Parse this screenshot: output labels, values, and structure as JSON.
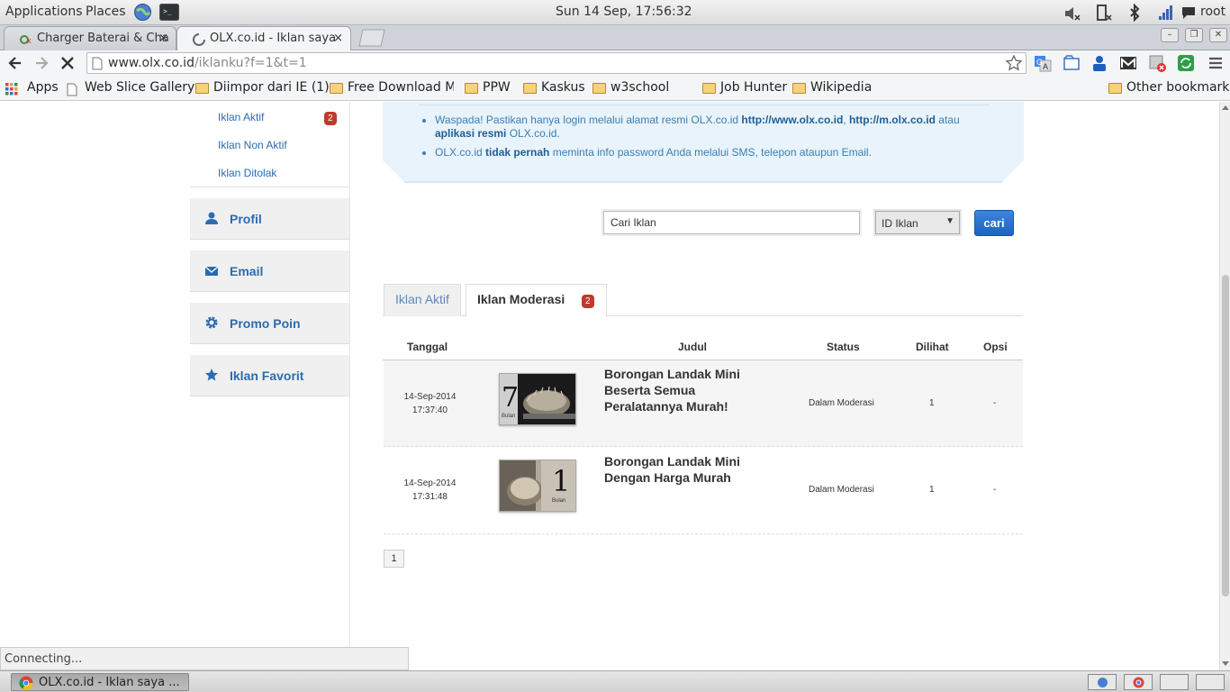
{
  "system_panel": {
    "applications": "Applications",
    "places": "Places",
    "clock": "Sun 14 Sep, 17:56:32",
    "user": "root"
  },
  "browser": {
    "tabs": [
      {
        "title": "Charger Baterai & Cha",
        "close": "×"
      },
      {
        "title": "OLX.co.id - Iklan saya",
        "close": "×"
      }
    ],
    "window_buttons": [
      "–",
      "❐",
      "✕"
    ],
    "url_host": "www.olx.co.id",
    "url_path": "/iklanku?f=1&t=1",
    "bookmarks": [
      "Apps",
      "Web Slice Gallery",
      "Diimpor dari IE (1)",
      "Free Download MF",
      "PPW",
      "Kaskus",
      "w3school",
      "Job Hunter",
      "Wikipedia"
    ],
    "other_bookmarks": "Other bookmarks",
    "status": "Connecting..."
  },
  "sidebar": {
    "submenu": [
      {
        "label": "Iklan Aktif",
        "badge": "2"
      },
      {
        "label": "Iklan Non Aktif"
      },
      {
        "label": "Iklan Ditolak"
      }
    ],
    "buttons": [
      "Profil",
      "Email",
      "Promo Poin",
      "Iklan Favorit"
    ]
  },
  "notice": {
    "item1_pre": "Waspada! Pastikan hanya login melalui alamat resmi OLX.co.id ",
    "item1_link1": "http://www.olx.co.id",
    "item1_sep": ", ",
    "item1_link2": "http://m.olx.co.id",
    "item1_mid": " atau ",
    "item1_bold": "aplikasi resmi",
    "item1_post": " OLX.co.id.",
    "item2_pre": "OLX.co.id ",
    "item2_bold": "tidak pernah",
    "item2_post": " meminta info password Anda melalui SMS, telepon ataupun Email."
  },
  "search": {
    "input_value": "Cari Iklan",
    "select_value": "ID Iklan",
    "button": "cari"
  },
  "listing_tabs": {
    "inactive": "Iklan Aktif",
    "active": "Iklan Moderasi",
    "active_badge": "2"
  },
  "table": {
    "headers": [
      "Tanggal",
      "Judul",
      "Status",
      "Dilihat",
      "Opsi"
    ],
    "rows": [
      {
        "date": "14-Sep-2014",
        "time": "17:37:40",
        "title": "Borongan Landak Mini Beserta Semua Peralatannya Murah!",
        "status": "Dalam Moderasi",
        "views": "1",
        "opsi": "-",
        "thumb_text": "7",
        "thumb_sub": "Bulan"
      },
      {
        "date": "14-Sep-2014",
        "time": "17:31:48",
        "title": "Borongan Landak Mini Dengan Harga Murah",
        "status": "Dalam Moderasi",
        "views": "1",
        "opsi": "-",
        "thumb_text": "1",
        "thumb_sub": "Bulan"
      }
    ]
  },
  "pagination": {
    "current": "1"
  },
  "taskbar": {
    "window_title": "OLX.co.id - Iklan saya ..."
  },
  "colors": {
    "link_blue": "#2b6cb0",
    "badge_red": "#c0392b",
    "button_blue": "#1c63c2"
  }
}
